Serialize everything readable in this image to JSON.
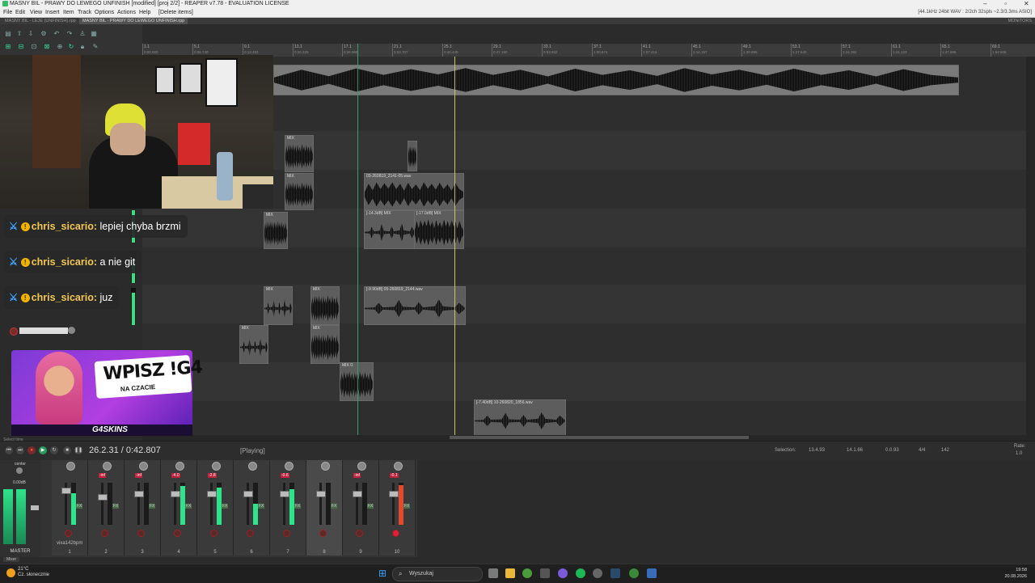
{
  "window": {
    "title": "MASNY BIL - PRAWY DO LEWEGO UNFINISH [modified] [proj 2/2] - REAPER v7.78 - EVALUATION LICENSE"
  },
  "menu": {
    "items": [
      "File",
      "Edit",
      "View",
      "Insert",
      "Item",
      "Track",
      "Options",
      "Actions",
      "Help",
      "[Delete items]"
    ],
    "audio_status": "[44.1kHz 24bit WAV : 2/2ch 32spls ~2.3/3.3ms ASIO]"
  },
  "project_tabs": {
    "tab1": "MASNY BIL - LEJE (UNFINISH).rpp",
    "tab2": "MASNY BIL - PRAWY DO LEWEGO UNFINISH.rpp",
    "monitor": "MONITORS"
  },
  "ruler": {
    "marks": [
      "1.1",
      "5.1",
      "9.1",
      "13.1",
      "17.1",
      "21.1",
      "25.1",
      "29.1",
      "33.1",
      "37.1",
      "41.1",
      "45.1",
      "49.1",
      "53.1",
      "57.1",
      "61.1",
      "65.1",
      "69.1"
    ],
    "times": [
      "0:00.000",
      "0:06.740",
      "0:13.483",
      "0:20.225",
      "0:26.966",
      "0:33.707",
      "0:40.449",
      "0:47.190",
      "0:53.932",
      "1:00.674",
      "1:07.415",
      "1:14.157",
      "1:20.898",
      "1:27.640",
      "1:34.382",
      "1:41.123",
      "1:47.865",
      "1:54.606"
    ]
  },
  "clips": {
    "c_mix1": "MIX",
    "c_mix2": "MIX",
    "c_03": "03-260819_2141-05.wav",
    "c_m14": "[-14.3dB] MIX",
    "c_m17": "[-17.0dB] MIX",
    "c_mix3": "MIX",
    "c_05": "[-9.90dB] 05-260819_2144.wav",
    "c_mix4": "MIX",
    "c_mix5": "MIX",
    "c_mix6": "MIX",
    "c_mix7": "MIX",
    "c_mix8": "MIX 0.",
    "c_10": "[-7.40dB] 10-260820_1856.wav"
  },
  "chat": {
    "messages": [
      {
        "user": "chris_sicario:",
        "text": "lepiej chyba brzmi"
      },
      {
        "user": "chris_sicario:",
        "text": "a nie git"
      },
      {
        "user": "chris_sicario:",
        "text": "juz"
      }
    ]
  },
  "ad": {
    "headline": "WPISZ !G4",
    "sub": "NA CZACIE",
    "brand": "G4SKINS"
  },
  "transport": {
    "time": "26.2.31 / 0:42.807",
    "state": "[Playing]",
    "status_left": "Select time",
    "selection_label": "Selection:",
    "sel_start": "13.4.93",
    "sel_end": "14.1.66",
    "sel_len": "0.0.93",
    "timesig": "4/4",
    "bpm": "142",
    "rate_label": "Rate:",
    "rate": "1.0"
  },
  "mixer": {
    "master_label": "MASTER",
    "master_center": "center",
    "master_db": "0.00dB",
    "mixer_tab": "Mixer",
    "track_name": "vixa142bpm",
    "channels": [
      {
        "num": "1",
        "peak": "",
        "meter": 0.75,
        "fader": 0.2
      },
      {
        "num": "2",
        "peak": "-inf",
        "meter": 0.0,
        "fader": 0.35
      },
      {
        "num": "3",
        "peak": "-inf",
        "meter": 0.0,
        "fader": 0.3
      },
      {
        "num": "4",
        "peak": "-4.0",
        "meter": 0.92,
        "fader": 0.3
      },
      {
        "num": "5",
        "peak": "-2.8",
        "meter": 0.88,
        "fader": 0.3
      },
      {
        "num": "6",
        "peak": "",
        "meter": 0.5,
        "fader": 0.3
      },
      {
        "num": "7",
        "peak": "-0.6",
        "meter": 0.85,
        "fader": 0.3
      },
      {
        "num": "8",
        "peak": "",
        "meter": 0.0,
        "fader": 0.3
      },
      {
        "num": "9",
        "peak": "-inf",
        "meter": 0.0,
        "fader": 0.3
      },
      {
        "num": "10",
        "peak": "-0.1",
        "meter": 0.95,
        "fader": 0.3
      }
    ]
  },
  "taskbar": {
    "weather_temp": "21°C",
    "weather_desc": "Cz. słonecznie",
    "search": "Wyszukaj",
    "time": "19:58",
    "date": "20.08.2026"
  },
  "colors": {
    "meter_green": "#2fe38a",
    "play_cursor": "#c9c46a",
    "edit_cursor": "#3e9c6e",
    "record_red": "#c0203a"
  }
}
